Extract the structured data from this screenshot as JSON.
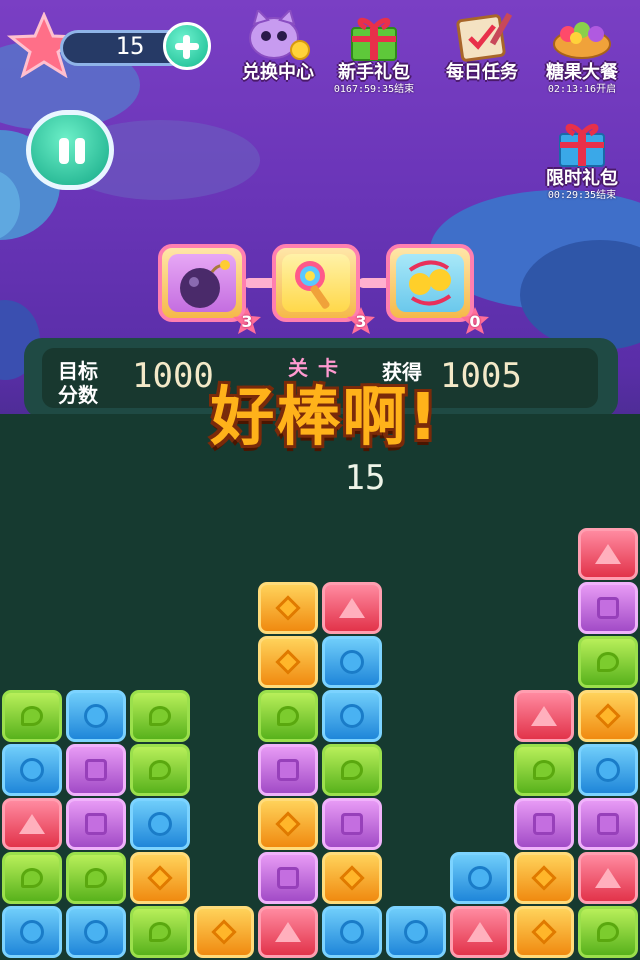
{
  "top_bar": {
    "star_count": "15",
    "shop_items": [
      {
        "label": "兑换中心",
        "timer": "",
        "icon": "cat-coin-icon"
      },
      {
        "label": "新手礼包",
        "timer": "0167:59:35结束",
        "icon": "green-gift-icon"
      },
      {
        "label": "每日任务",
        "timer": "",
        "icon": "task-scroll-icon"
      },
      {
        "label": "糖果大餐",
        "timer": "02:13:16开启",
        "icon": "candy-basket-icon"
      }
    ],
    "limited_gift": {
      "label": "限时礼包",
      "timer": "00:29:35结束",
      "icon": "blue-gift-icon"
    }
  },
  "props": [
    {
      "icon": "bomb-icon",
      "count": "3"
    },
    {
      "icon": "magic-wand-icon",
      "count": "3"
    },
    {
      "icon": "swap-icon",
      "count": "0"
    }
  ],
  "panel": {
    "target_label_1": "目标",
    "target_label_2": "分数",
    "target_value": "1000",
    "level_label": "关卡",
    "level_value": "15",
    "gained_label": "获得",
    "gained_value": "1005"
  },
  "overlay": {
    "message": "好棒啊!"
  },
  "colors": {
    "green": "#58b21c",
    "blue": "#1f86d9",
    "red": "#e2334a",
    "purple": "#a24bc7",
    "orange": "#f08a10"
  },
  "board": {
    "columns": 10,
    "rows_bottom_up": [
      [
        "blue",
        "blue",
        "green",
        "orange",
        "red",
        "blue",
        "blue",
        "red",
        "orange",
        "green"
      ],
      [
        "green",
        "green",
        "orange",
        "",
        "purple",
        "orange",
        "",
        "blue",
        "orange",
        "red"
      ],
      [
        "red",
        "purple",
        "blue",
        "",
        "orange",
        "purple",
        "",
        "",
        "purple",
        "purple"
      ],
      [
        "blue",
        "purple",
        "green",
        "",
        "purple",
        "green",
        "",
        "",
        "green",
        "blue"
      ],
      [
        "green",
        "blue",
        "green",
        "",
        "green",
        "blue",
        "",
        "",
        "red",
        "orange"
      ],
      [
        "",
        "",
        "",
        "",
        "orange",
        "blue",
        "",
        "",
        "",
        "green"
      ],
      [
        "",
        "",
        "",
        "",
        "orange",
        "red",
        "",
        "",
        "",
        "purple"
      ],
      [
        "",
        "",
        "",
        "",
        "",
        "",
        "",
        "",
        "",
        "red"
      ]
    ]
  }
}
